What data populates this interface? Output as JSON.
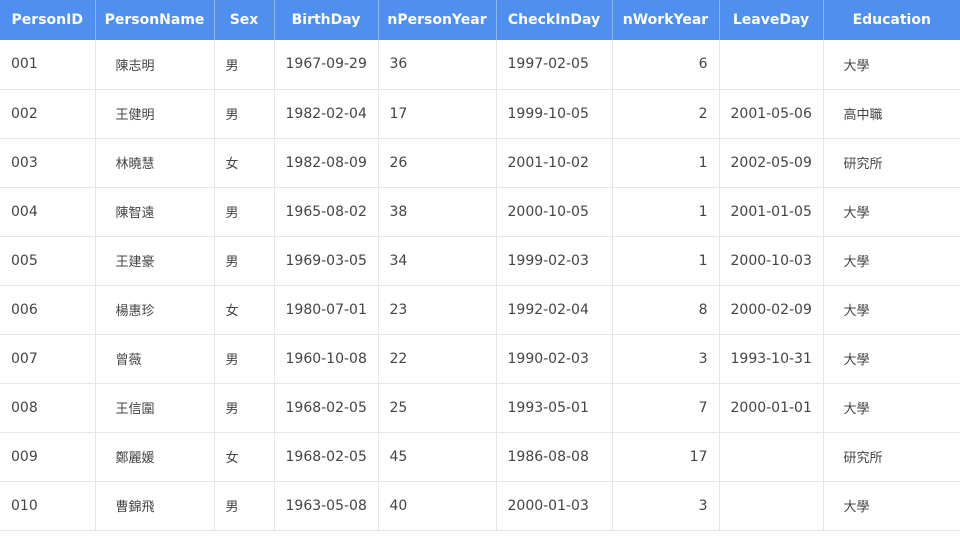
{
  "columns": [
    "PersonID",
    "PersonName",
    "Sex",
    "BirthDay",
    "nPersonYear",
    "CheckInDay",
    "nWorkYear",
    "LeaveDay",
    "Education"
  ],
  "rows": [
    [
      "001",
      "陳志明",
      "男",
      "1967-09-29",
      "36",
      "1997-02-05",
      "6",
      "",
      "大學"
    ],
    [
      "002",
      "王健明",
      "男",
      "1982-02-04",
      "17",
      "1999-10-05",
      "2",
      "2001-05-06",
      "高中職"
    ],
    [
      "003",
      "林曉慧",
      "女",
      "1982-08-09",
      "26",
      "2001-10-02",
      "1",
      "2002-05-09",
      "研究所"
    ],
    [
      "004",
      "陳智遠",
      "男",
      "1965-08-02",
      "38",
      "2000-10-05",
      "1",
      "2001-01-05",
      "大學"
    ],
    [
      "005",
      "王建豪",
      "男",
      "1969-03-05",
      "34",
      "1999-02-03",
      "1",
      "2000-10-03",
      "大學"
    ],
    [
      "006",
      "楊惠珍",
      "女",
      "1980-07-01",
      "23",
      "1992-02-04",
      "8",
      "2000-02-09",
      "大學"
    ],
    [
      "007",
      "曾薇",
      "男",
      "1960-10-08",
      "22",
      "1990-02-03",
      "3",
      "1993-10-31",
      "大學"
    ],
    [
      "008",
      "王信圍",
      "男",
      "1968-02-05",
      "25",
      "1993-05-01",
      "7",
      "2000-01-01",
      "大學"
    ],
    [
      "009",
      "鄭麗媛",
      "女",
      "1968-02-05",
      "45",
      "1986-08-08",
      "17",
      "",
      "研究所"
    ],
    [
      "010",
      "曹錦飛",
      "男",
      "1963-05-08",
      "40",
      "2000-01-03",
      "3",
      "",
      "大學"
    ]
  ],
  "colors": {
    "header_bg": "#4f8ff0",
    "header_text": "#ffffff",
    "grid_line": "#e6e6e6"
  }
}
